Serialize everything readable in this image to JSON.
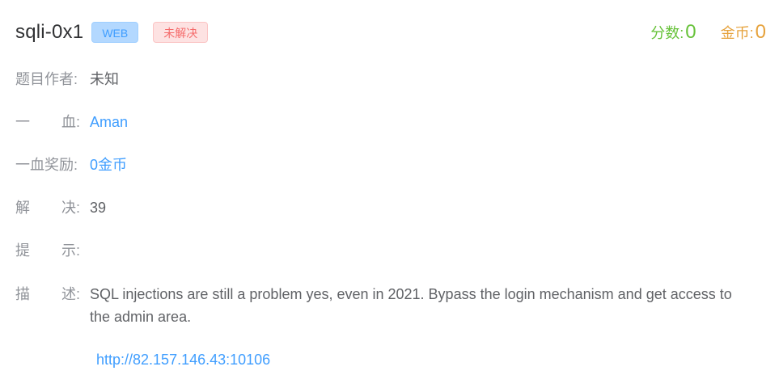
{
  "challenge": {
    "title": "sqli-0x1",
    "type_tag": "WEB",
    "status_tag": "未解决"
  },
  "stats": {
    "score_label": "分数:",
    "score_value": "0",
    "coins_label": "金币:",
    "coins_value": "0"
  },
  "details": {
    "author": {
      "label": "题目作者",
      "colon": ":",
      "value": "未知"
    },
    "first_blood": {
      "label_a": "一",
      "label_b": "血",
      "colon": ":",
      "value": "Aman"
    },
    "blood_reward": {
      "label": "一血奖励",
      "colon": ":",
      "value": "0金币"
    },
    "solved": {
      "label_a": "解",
      "label_b": "决",
      "colon": ":",
      "value": "39"
    },
    "hint": {
      "label_a": "提",
      "label_b": "示",
      "colon": ":",
      "value": ""
    },
    "description": {
      "label_a": "描",
      "label_b": "述",
      "colon": ":",
      "value": "SQL injections are still a problem yes, even in 2021. Bypass the login mechanism and get access to the admin area."
    },
    "url": "http://82.157.146.43:10106"
  },
  "colors": {
    "link": "#409eff",
    "score": "#67c23a",
    "coins": "#e6a23c",
    "status_tag_bg": "#fde2e2",
    "type_tag_bg": "#b3d8ff"
  }
}
